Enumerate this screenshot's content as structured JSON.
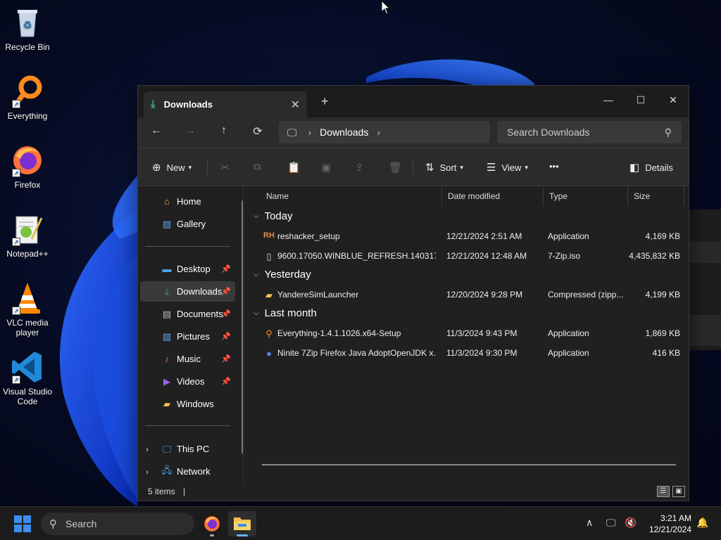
{
  "desktop": {
    "icons": [
      {
        "label": "Recycle Bin",
        "icon": "recycle-bin-icon"
      },
      {
        "label": "Everything",
        "icon": "everything-search-icon"
      },
      {
        "label": "Firefox",
        "icon": "firefox-icon"
      },
      {
        "label": "Notepad++",
        "icon": "notepad-plus-plus-icon"
      },
      {
        "label": "VLC media player",
        "icon": "vlc-icon"
      },
      {
        "label": "Visual Studio Code",
        "icon": "vscode-icon"
      }
    ]
  },
  "window": {
    "tab_title": "Downloads",
    "new_tab_glyph": "+",
    "minimize_glyph": "—",
    "maximize_glyph": "☐",
    "close_glyph": "✕",
    "address": {
      "location": "Downloads"
    },
    "search": {
      "placeholder": "Search Downloads"
    },
    "toolbar": {
      "new_label": "New",
      "sort_label": "Sort",
      "view_label": "View",
      "more_label": "•••",
      "details_label": "Details"
    },
    "sidebar": {
      "top": [
        {
          "label": "Home",
          "icon": "home-icon"
        },
        {
          "label": "Gallery",
          "icon": "gallery-icon"
        }
      ],
      "pinned": [
        {
          "label": "Desktop",
          "icon": "desktop-folder-icon",
          "pinned": true
        },
        {
          "label": "Downloads",
          "icon": "downloads-folder-icon",
          "pinned": true,
          "selected": true
        },
        {
          "label": "Documents",
          "icon": "documents-folder-icon",
          "pinned": true
        },
        {
          "label": "Pictures",
          "icon": "pictures-folder-icon",
          "pinned": true
        },
        {
          "label": "Music",
          "icon": "music-folder-icon",
          "pinned": true
        },
        {
          "label": "Videos",
          "icon": "videos-folder-icon",
          "pinned": true
        },
        {
          "label": "Windows",
          "icon": "folder-icon",
          "pinned": false
        }
      ],
      "bottom": [
        {
          "label": "This PC",
          "icon": "this-pc-icon"
        },
        {
          "label": "Network",
          "icon": "network-icon"
        }
      ]
    },
    "columns": {
      "name": "Name",
      "date": "Date modified",
      "type": "Type",
      "size": "Size"
    },
    "groups": [
      {
        "label": "Today",
        "files": [
          {
            "name": "reshacker_setup",
            "date": "12/21/2024 2:51 AM",
            "type": "Application",
            "size": "4,169 KB",
            "icon": "reshacker-icon"
          },
          {
            "name": "9600.17050.WINBLUE_REFRESH.140317-1...",
            "date": "12/21/2024 12:48 AM",
            "type": "7-Zip.iso",
            "size": "4,435,832 KB",
            "icon": "file-icon"
          }
        ]
      },
      {
        "label": "Yesterday",
        "files": [
          {
            "name": "YandereSimLauncher",
            "date": "12/20/2024 9:28 PM",
            "type": "Compressed (zipp...",
            "size": "4,199 KB",
            "icon": "zip-folder-icon"
          }
        ]
      },
      {
        "label": "Last month",
        "files": [
          {
            "name": "Everything-1.4.1.1026.x64-Setup",
            "date": "11/3/2024 9:43 PM",
            "type": "Application",
            "size": "1,869 KB",
            "icon": "everything-search-icon"
          },
          {
            "name": "Ninite 7Zip Firefox Java AdoptOpenJDK x...",
            "date": "11/3/2024 9:30 PM",
            "type": "Application",
            "size": "416 KB",
            "icon": "ninite-icon"
          }
        ]
      }
    ],
    "status": {
      "item_count": "5 items"
    }
  },
  "taskbar": {
    "search_label": "Search",
    "time": "3:21 AM",
    "date": "12/21/2024"
  }
}
